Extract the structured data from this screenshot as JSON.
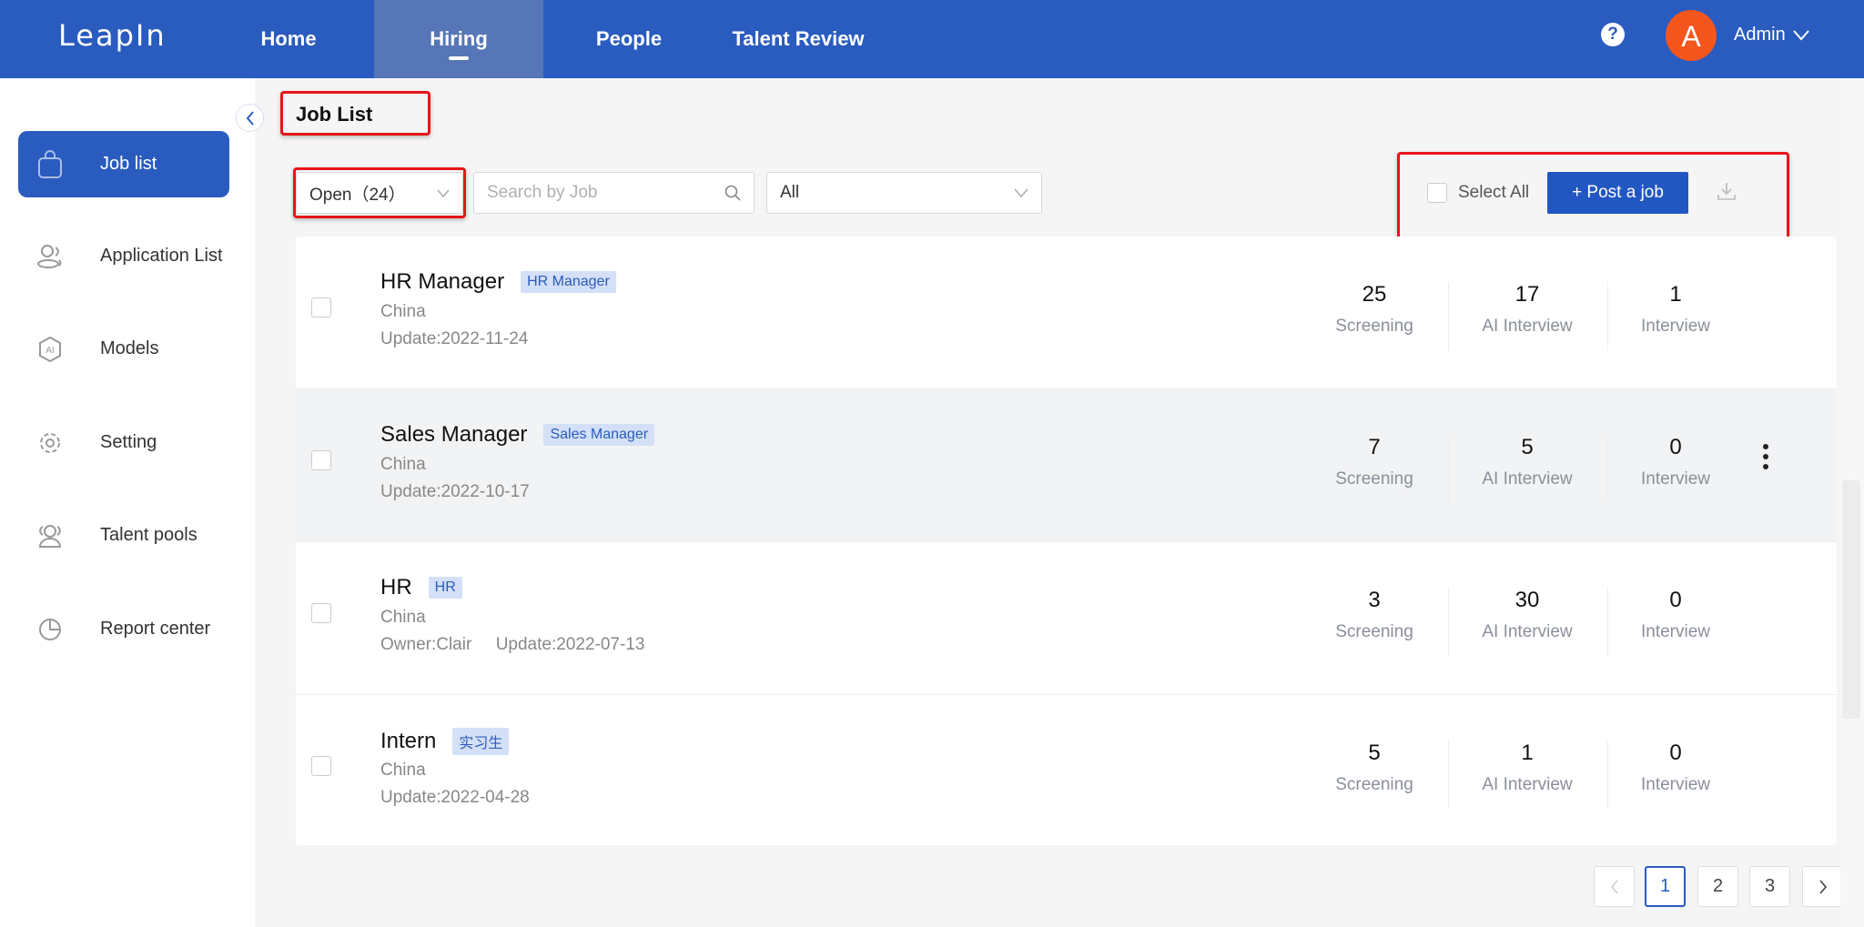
{
  "header": {
    "logo": "LeapIn",
    "nav": [
      {
        "label": "Home"
      },
      {
        "label": "Hiring",
        "active": true
      },
      {
        "label": "People"
      },
      {
        "label": "Talent Review"
      }
    ],
    "help": "?",
    "avatar_initial": "A",
    "user": "Admin"
  },
  "sidebar": {
    "items": [
      {
        "label": "Job list",
        "icon": "bag-icon"
      },
      {
        "label": "Application List",
        "icon": "users-icon"
      },
      {
        "label": "Models",
        "icon": "ai-hexagon-icon"
      },
      {
        "label": "Setting",
        "icon": "gear-icon"
      },
      {
        "label": "Talent pools",
        "icon": "group-icon"
      },
      {
        "label": "Report center",
        "icon": "pie-chart-icon"
      }
    ]
  },
  "page": {
    "title": "Job List"
  },
  "filters": {
    "status": "Open（24）",
    "search_placeholder": "Search by Job",
    "category": "All"
  },
  "actions": {
    "select_all": "Select All",
    "post_job": "+ Post a job"
  },
  "jobs": [
    {
      "title": "HR Manager",
      "tag": "HR Manager",
      "location": "China",
      "meta": "Update:2022-11-24",
      "screening": "25",
      "ai_interview": "17",
      "interview": "1"
    },
    {
      "title": "Sales Manager",
      "tag": "Sales Manager",
      "location": "China",
      "meta": "Update:2022-10-17",
      "screening": "7",
      "ai_interview": "5",
      "interview": "0"
    },
    {
      "title": "HR",
      "tag": "HR",
      "location": "China",
      "meta": "Owner:Clair     Update:2022-07-13",
      "screening": "3",
      "ai_interview": "30",
      "interview": "0"
    },
    {
      "title": "Intern",
      "tag": "实习生",
      "location": "China",
      "meta": "Update:2022-04-28",
      "screening": "5",
      "ai_interview": "1",
      "interview": "0"
    }
  ],
  "stat_labels": {
    "screening": "Screening",
    "ai_interview": "AI Interview",
    "interview": "Interview"
  },
  "pagination": {
    "pages": [
      "1",
      "2",
      "3"
    ],
    "current": "1"
  },
  "colors": {
    "primary": "#2a5bbf",
    "avatar": "#f5561e",
    "highlight": "#e8141a"
  }
}
